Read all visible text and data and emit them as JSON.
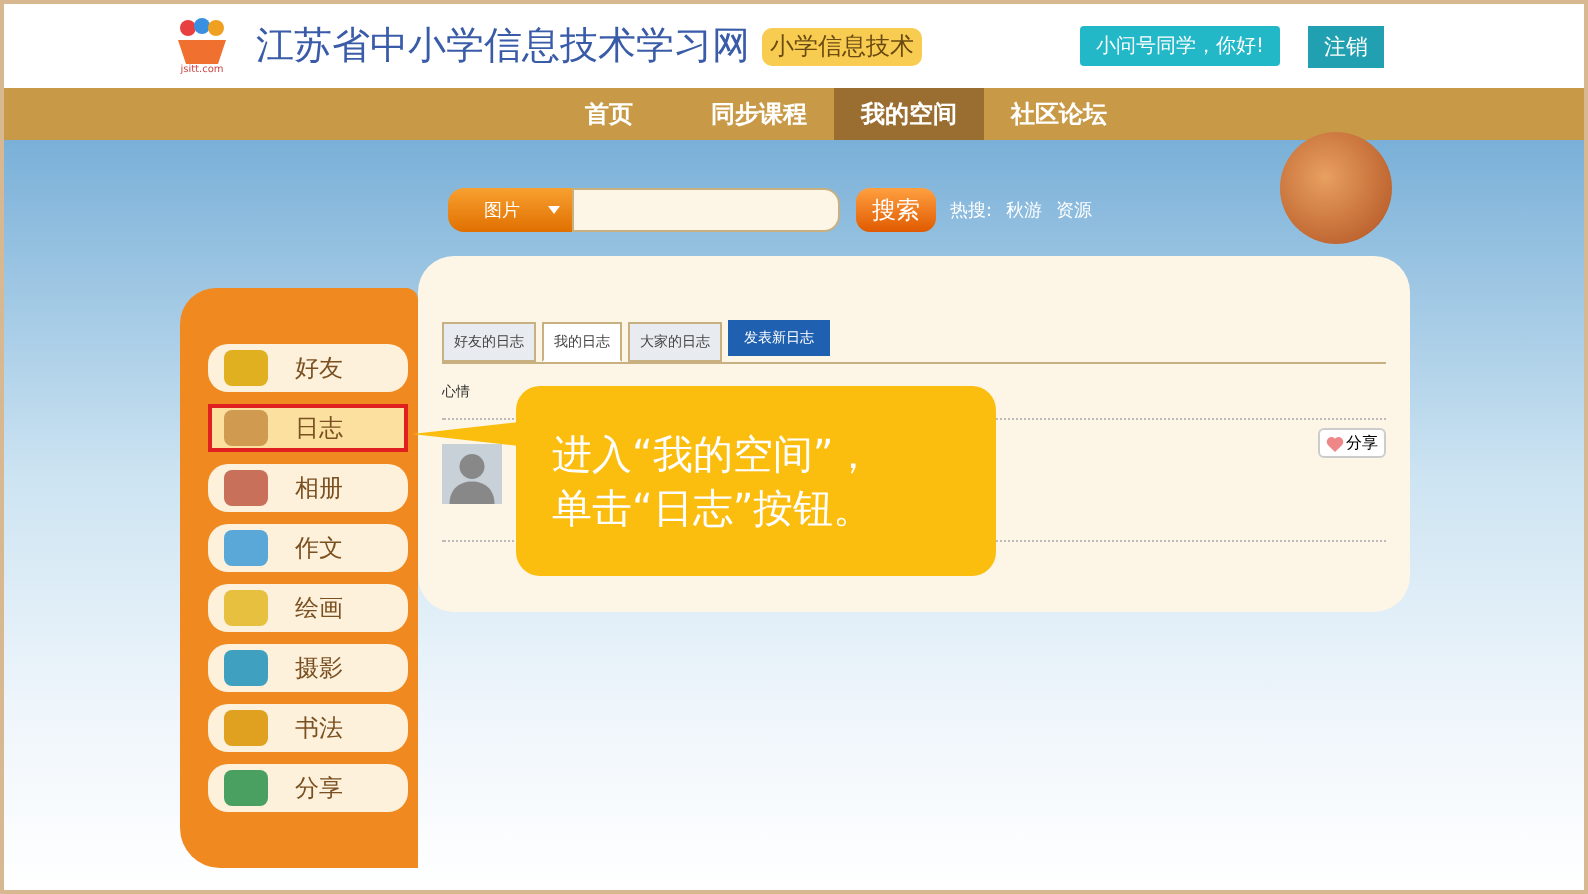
{
  "header": {
    "site_title": "江苏省中小学信息技术学习网",
    "site_badge": "小学信息技术",
    "logo_caption": "jsitt.com",
    "greeting": "小问号同学，你好!",
    "logout": "注销"
  },
  "nav": [
    {
      "label": "首页",
      "selected": false
    },
    {
      "label": "同步课程",
      "selected": false
    },
    {
      "label": "我的空间",
      "selected": true
    },
    {
      "label": "社区论坛",
      "selected": false
    }
  ],
  "search": {
    "category": "图片",
    "button": "搜索",
    "hot_label": "热搜:",
    "hot_terms": [
      "秋游",
      "资源"
    ]
  },
  "sidebar": {
    "items": [
      {
        "label": "好友",
        "selected": false
      },
      {
        "label": "日志",
        "selected": true
      },
      {
        "label": "相册",
        "selected": false
      },
      {
        "label": "作文",
        "selected": false
      },
      {
        "label": "绘画",
        "selected": false
      },
      {
        "label": "摄影",
        "selected": false
      },
      {
        "label": "书法",
        "selected": false
      },
      {
        "label": "分享",
        "selected": false
      }
    ]
  },
  "diary": {
    "tabs": [
      {
        "label": "好友的日志",
        "selected": false
      },
      {
        "label": "我的日志",
        "selected": true
      },
      {
        "label": "大家的日志",
        "selected": false
      }
    ],
    "new_button": "发表新日志",
    "mood_label": "心情",
    "share_button": "分享"
  },
  "callout": {
    "lines": [
      "进入“我的空间”，",
      "单击“日志”按钮。"
    ]
  }
}
